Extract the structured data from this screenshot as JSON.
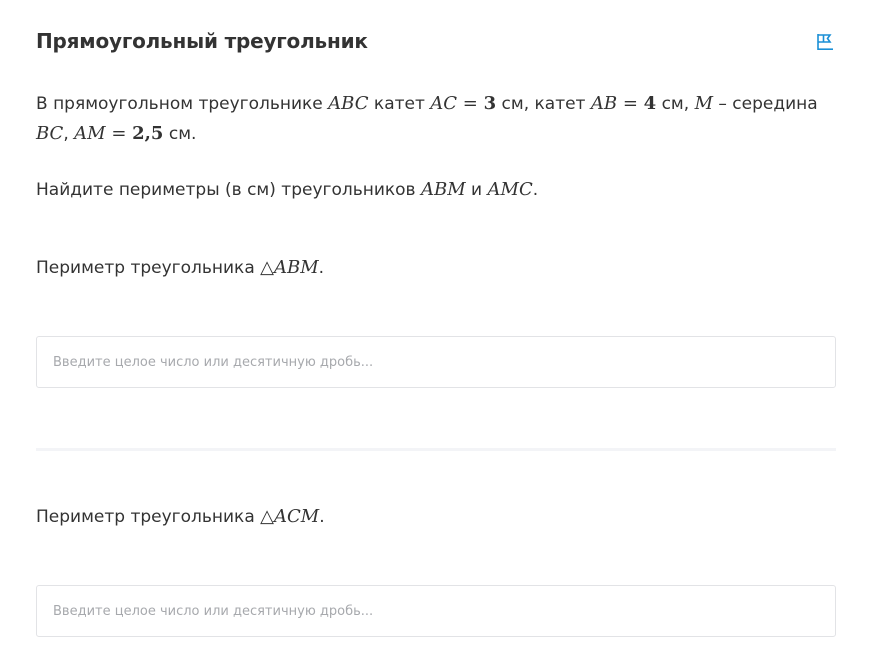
{
  "header": {
    "title": "Прямоугольный треугольник",
    "flag_icon": "flag-icon",
    "accent_color": "#1a8fd6"
  },
  "problem": {
    "intro_1": "В прямоугольном треугольнике ",
    "abc": "ABC",
    "leg_word_1": " катет ",
    "ac": "AC",
    "eq_1": " = ",
    "ac_value": "3",
    "unit_1": " см, катет ",
    "ab": "AB",
    "eq_2": " = ",
    "ab_value": "4",
    "unit_2": " см, ",
    "m": "M",
    "dash_midpoint": " – середина ",
    "bc": "BC",
    "comma": ", ",
    "am": "AM",
    "eq_3": " = ",
    "am_value": "2,5",
    "unit_3": " см.",
    "task_1": "Найдите периметры (в см) треугольников ",
    "abm": "ABM",
    "and": " и ",
    "amc": "AMC",
    "task_end": "."
  },
  "questions": [
    {
      "prefix": "Периметр треугольника ",
      "triangle_symbol": "△",
      "name": "ABM",
      "suffix": ".",
      "placeholder": "Введите целое число или десятичную дробь..."
    },
    {
      "prefix": "Периметр треугольника ",
      "triangle_symbol": "△",
      "name": "ACM",
      "suffix": ".",
      "placeholder": "Введите целое число или десятичную дробь..."
    }
  ]
}
